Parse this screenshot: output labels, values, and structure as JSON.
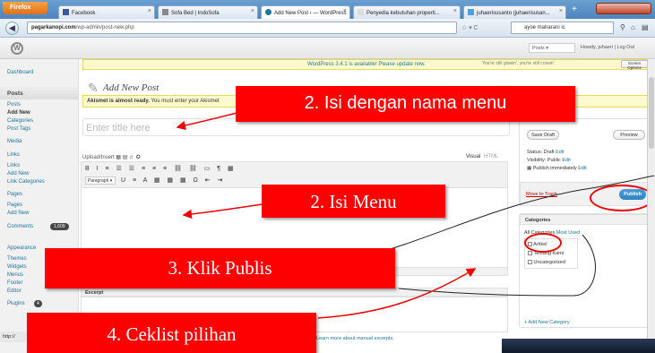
{
  "browser": {
    "firefox_label": "Firefox",
    "tabs": [
      {
        "label": "Facebook"
      },
      {
        "label": "Sofa Bed | IndoSofa"
      },
      {
        "label": "Add New Post ‹ — WordPress"
      },
      {
        "label": "Penyedia kebutuhan properti..."
      },
      {
        "label": "juhaerisusanto (juhaerisusan..."
      }
    ],
    "new_tab": "+",
    "url_domain": "pagarkanopi.com",
    "url_path": "/wp-admin/post-new.php",
    "search_value": "ayoe maharani ic"
  },
  "wp": {
    "logo": "W",
    "update_notice": "WordPress 3.4.1 is available! Please update now.",
    "hello_dolly": "You're still glowin', you're still crowin'",
    "screen_options": "Screen Options",
    "help": "Help",
    "posts_select": "Posts",
    "howdy": "Howdy, juhaeri | Log Out",
    "page_title": "Add New Post",
    "akismet_notice_bold": "Akismet is almost ready.",
    "akismet_notice_rest": "You must enter your Akismet",
    "title_placeholder": "Enter title here",
    "upload_insert": "Upload/Insert",
    "tab_visual": "Visual",
    "tab_html": "HTML",
    "format_select": "Paragraph",
    "excerpt_label": "Excerpt",
    "excerpt_link": "Learn more about manual excerpts.",
    "status_bar": "http://"
  },
  "sidebar": {
    "dashboard": "Dashboard",
    "posts": "Posts",
    "posts_sub": [
      "Posts",
      "Add New",
      "Categories",
      "Post Tags"
    ],
    "media": "Media",
    "links": "Links",
    "links_sub": [
      "Links",
      "Add New",
      "Link Categories"
    ],
    "pages": "Pages",
    "pages_sub": [
      "Pages",
      "Add New"
    ],
    "comments": "Comments",
    "comments_count": "1,609",
    "appearance": "Appearance",
    "appearance_sub": [
      "Themes",
      "Widgets",
      "Menus",
      "Footer",
      "Editor"
    ],
    "plugins": "Plugins",
    "plugins_count": "4"
  },
  "publish": {
    "save_draft": "Save Draft",
    "preview": "Preview",
    "status": "Status: Draft",
    "status_edit": "Edit",
    "visibility": "Visibility: Public",
    "visibility_edit": "Edit",
    "schedule": "Publish immediately",
    "schedule_edit": "Edit",
    "trash": "Move to Trash",
    "publish_button": "Publish"
  },
  "categories": {
    "title": "Categories",
    "tab_all": "All Categories",
    "tab_most": "Most Used",
    "items": [
      "Artikel",
      "Tentang Kami",
      "Uncategorized"
    ],
    "add_new": "+ Add New Category"
  },
  "annotations": {
    "a1": "2.    Isi dengan nama menu",
    "a2": "2. Isi Menu",
    "a3": "3. Klik Publis",
    "a4": "4. Ceklist pilihan"
  },
  "colors": {
    "annotation_red": "#ff0000",
    "wp_link": "#21759b",
    "publish_blue": "#2e84c3"
  }
}
